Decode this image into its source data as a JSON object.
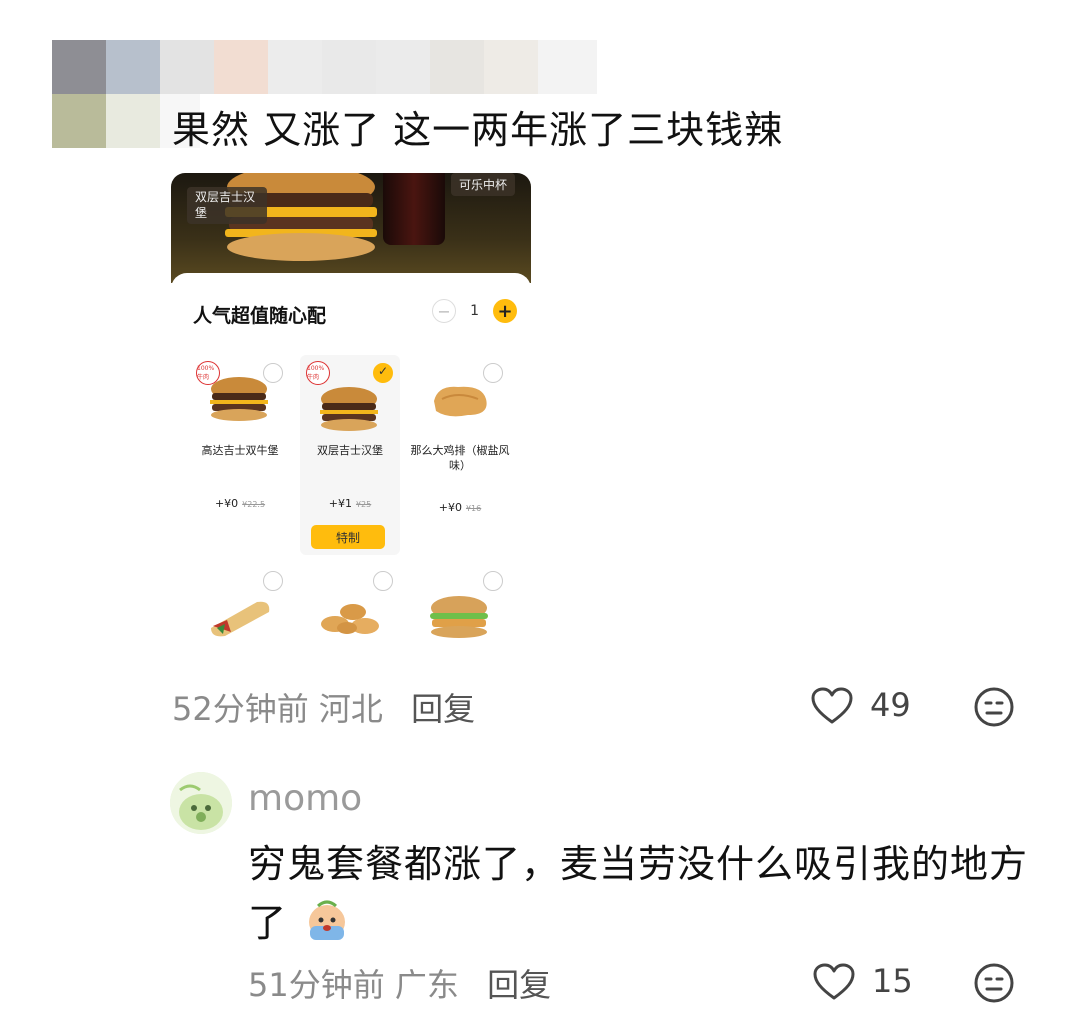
{
  "comment1": {
    "text": "果然 又涨了 这一两年涨了三块钱辣",
    "time": "52分钟前",
    "location": "河北",
    "reply_label": "回复",
    "likes": "49",
    "like_icon": "heart-outline-icon",
    "react_icon": "emoji-face-icon"
  },
  "embedded": {
    "hero_tag_left": "双层吉士汉堡",
    "hero_tag_right": "可乐中杯",
    "section_title": "人气超值随心配",
    "stepper_minus": "−",
    "stepper_value": "1",
    "stepper_plus": "+",
    "items": [
      {
        "name": "高达吉士双牛堡",
        "price": "+¥0",
        "old_price": "¥22.5",
        "badge": "100%牛肉",
        "selected": false
      },
      {
        "name": "双层吉士汉堡",
        "price": "+¥1",
        "old_price": "¥25",
        "badge": "100%牛肉",
        "selected": true,
        "button": "特制"
      },
      {
        "name": "那么大鸡排（椒盐风味）",
        "price": "+¥0",
        "old_price": "¥16",
        "selected": false
      }
    ]
  },
  "reply": {
    "username": "momo",
    "text": "穷鬼套餐都涨了，麦当劳没什么吸引我的地方了",
    "emoji": "crying-emoji-icon",
    "time": "51分钟前",
    "location": "广东",
    "reply_label": "回复",
    "likes": "15"
  },
  "colors": {
    "accent_yellow": "#ffbc0d",
    "meta_gray": "#8a8a8a"
  }
}
